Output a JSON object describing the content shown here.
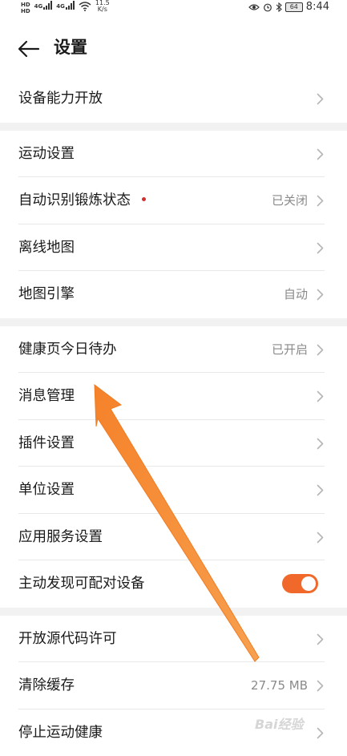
{
  "status_bar": {
    "network_top": "HD",
    "network_bottom": "HD",
    "sig1_label": "4G",
    "sig2_label": "4G",
    "speed_value": "11.5",
    "speed_unit": "K/s",
    "battery": "64",
    "time": "8:44",
    "icons": [
      "wifi-icon",
      "eye-icon",
      "alarm-icon",
      "bluetooth-icon"
    ]
  },
  "header": {
    "title": "设置",
    "back_icon": "arrow-left-icon"
  },
  "groups": [
    [
      {
        "label": "设备能力开放",
        "value": ""
      }
    ],
    [
      {
        "label": "运动设置",
        "value": ""
      },
      {
        "label": "自动识别锻炼状态",
        "value": "已关闭",
        "dot": true
      },
      {
        "label": "离线地图",
        "value": ""
      },
      {
        "label": "地图引擎",
        "value": "自动"
      }
    ],
    [
      {
        "label": "健康页今日待办",
        "value": "已开启"
      },
      {
        "label": "消息管理",
        "value": ""
      },
      {
        "label": "插件设置",
        "value": ""
      },
      {
        "label": "单位设置",
        "value": ""
      },
      {
        "label": "应用服务设置",
        "value": ""
      },
      {
        "label": "主动发现可配对设备",
        "value": "",
        "toggle": true,
        "toggle_on": true
      }
    ],
    [
      {
        "label": "开放源代码许可",
        "value": ""
      },
      {
        "label": "清除缓存",
        "value": "27.75 MB"
      },
      {
        "label": "停止运动健康",
        "value": ""
      }
    ]
  ],
  "colors": {
    "accent": "#f0692a",
    "annotation_arrow": "#f58a2f",
    "dot": "#d32f2f"
  },
  "watermark": "Bai经验"
}
